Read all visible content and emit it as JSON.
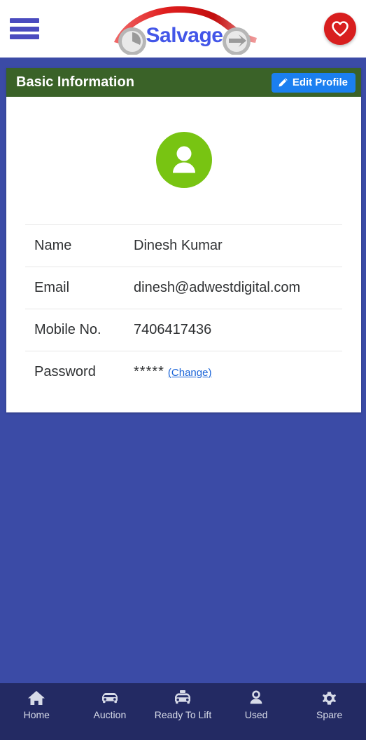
{
  "appbar": {
    "menu_icon": "hamburger-menu-icon",
    "brand_text": "Salvage",
    "favorite_icon": "heart-icon",
    "brand_color": "#4356e8",
    "favorite_bg": "#d81e1e"
  },
  "card": {
    "header": {
      "title": "Basic Information",
      "bg_color": "#3a6228",
      "edit_button": {
        "label": "Edit Profile",
        "icon": "pencil-icon",
        "bg_color": "#1b7ff0"
      }
    },
    "avatar": {
      "icon": "user-avatar-icon",
      "bg_color": "#78c412"
    },
    "rows": [
      {
        "label": "Name",
        "value": "Dinesh Kumar"
      },
      {
        "label": "Email",
        "value": "dinesh@adwestdigital.com"
      },
      {
        "label": "Mobile No.",
        "value": "7406417436"
      }
    ],
    "password_row": {
      "label": "Password",
      "masked_value": "*****",
      "change_link": "(Change)",
      "link_color": "#1a64d8"
    }
  },
  "bottom_nav": {
    "bg_color": "#232a63",
    "items": [
      {
        "label": "Home",
        "icon": "home-icon"
      },
      {
        "label": "Auction",
        "icon": "car-icon"
      },
      {
        "label": "Ready To Lift",
        "icon": "taxi-icon"
      },
      {
        "label": "Used",
        "icon": "person-icon"
      },
      {
        "label": "Spare",
        "icon": "gear-icon"
      }
    ]
  },
  "page": {
    "background_color": "#3b4ba6"
  }
}
